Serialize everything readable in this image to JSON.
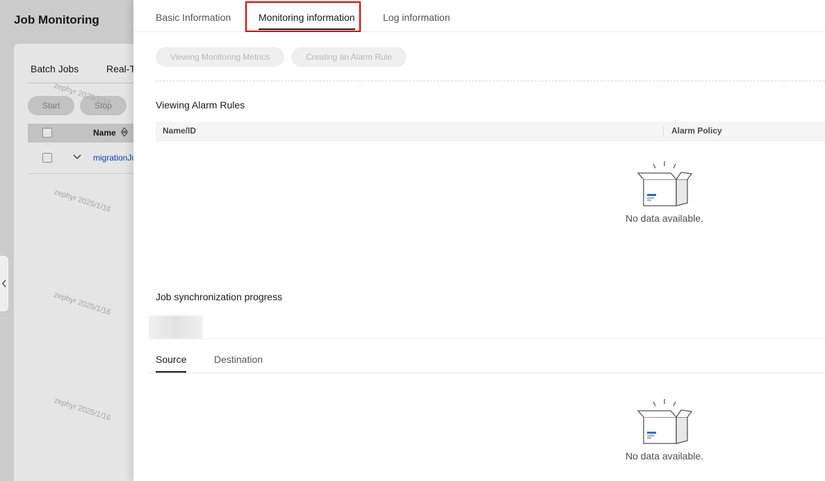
{
  "background": {
    "title": "Job Monitoring",
    "tabs": [
      "Batch Jobs",
      "Real-T"
    ],
    "buttons": {
      "start": "Start",
      "stop": "Stop"
    },
    "table": {
      "name_header": "Name",
      "row_link": "migrationJo"
    },
    "watermark_text": "zephyr 2025/1/16"
  },
  "drawer": {
    "tabs": [
      {
        "label": "Basic Information",
        "active": false
      },
      {
        "label": "Monitoring information",
        "active": true
      },
      {
        "label": "Log information",
        "active": false
      }
    ],
    "buttons": {
      "view_metrics": "Viewing Monitoring Metrics",
      "create_alarm": "Creating an Alarm Rule"
    },
    "alarm_rules": {
      "title": "Viewing Alarm Rules",
      "columns": [
        "Name/ID",
        "Alarm Policy"
      ],
      "empty_text": "No data available."
    },
    "sync_progress": {
      "title": "Job synchronization progress",
      "sub_tabs": [
        {
          "label": "Source",
          "active": true
        },
        {
          "label": "Destination",
          "active": false
        }
      ],
      "empty_text": "No data available."
    }
  },
  "colors": {
    "accent_red": "#e00000",
    "link_blue": "#0b4fc4",
    "icon_blue": "#1a6fe0"
  },
  "icons": {
    "collapse": "chevron-left-icon",
    "empty": "empty-box-icon",
    "sort": "sort-icon",
    "expand": "chevron-down-icon"
  }
}
